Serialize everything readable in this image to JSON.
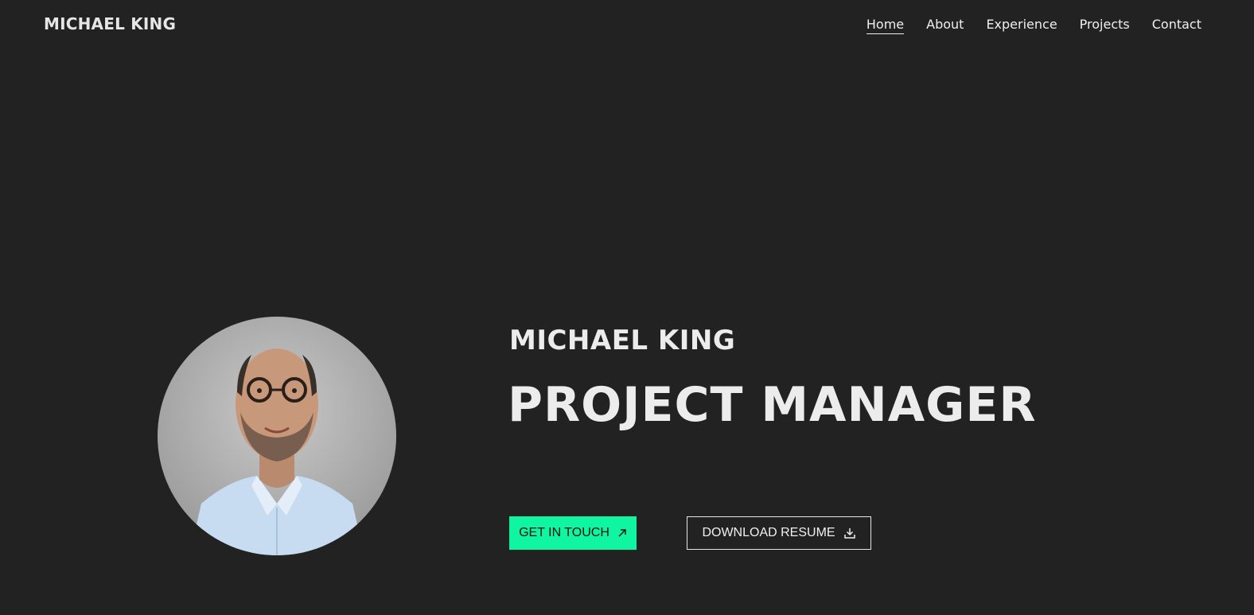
{
  "header": {
    "brand": "MICHAEL KING",
    "nav": [
      {
        "label": "Home",
        "active": true
      },
      {
        "label": "About",
        "active": false
      },
      {
        "label": "Experience",
        "active": false
      },
      {
        "label": "Projects",
        "active": false
      },
      {
        "label": "Contact",
        "active": false
      }
    ]
  },
  "hero": {
    "name": "MICHAEL KING",
    "title": "PROJECT MANAGER",
    "primary_button": {
      "label": "GET IN TOUCH",
      "icon": "arrow-up-right-icon"
    },
    "secondary_button": {
      "label": "DOWNLOAD RESUME",
      "icon": "download-icon"
    }
  },
  "colors": {
    "background": "#222222",
    "accent": "#10f5a2",
    "text": "#ececec"
  }
}
